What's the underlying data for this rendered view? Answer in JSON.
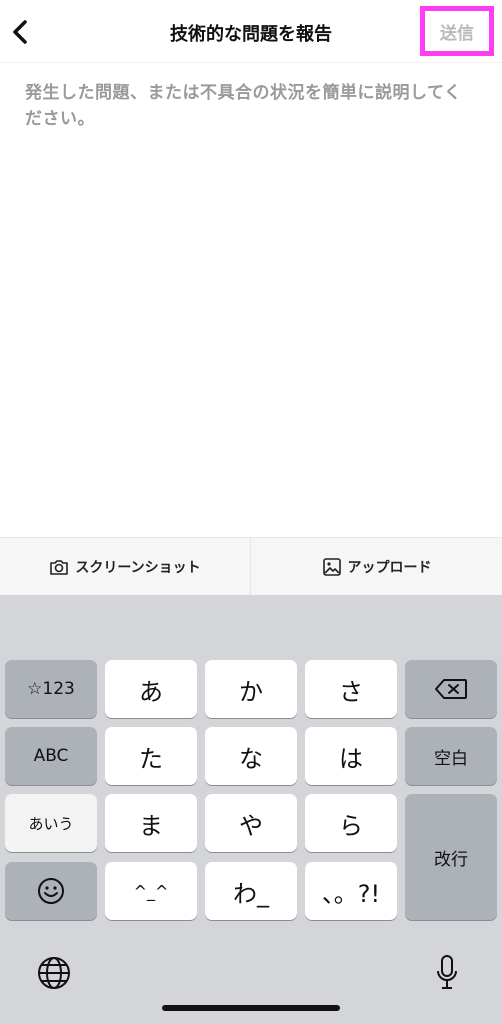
{
  "header": {
    "title": "技術的な問題を報告",
    "send_label": "送信"
  },
  "report": {
    "placeholder": "発生した問題、または不具合の状況を簡単に説明してください。"
  },
  "attachments": {
    "screenshot_label": "スクリーンショット",
    "upload_label": "アップロード"
  },
  "keyboard": {
    "row1": [
      "☆123",
      "あ",
      "か",
      "さ"
    ],
    "row2": [
      "ABC",
      "た",
      "な",
      "は",
      "空白"
    ],
    "row3": [
      "あいう",
      "ま",
      "や",
      "ら",
      "改行"
    ],
    "row4": [
      "^_^",
      "わ_",
      "、。?!"
    ]
  },
  "colors": {
    "highlight": "#ff3df5",
    "send_text": "#b9b9b9",
    "keyboard_bg": "#d4d5d8",
    "dark_key": "#adb1b8"
  }
}
